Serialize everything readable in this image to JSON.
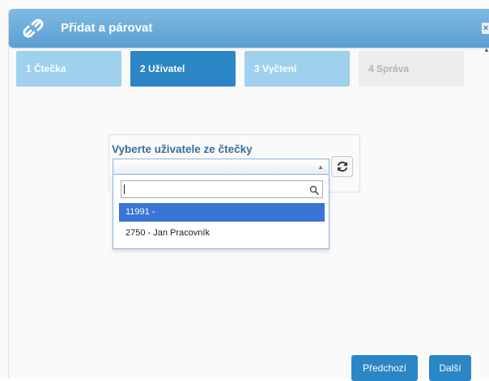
{
  "dialog": {
    "title": "Přidat a párovat",
    "close_label": "×",
    "title_icon": "link-icon"
  },
  "steps": [
    {
      "label": "1 Čtečka",
      "state": "done"
    },
    {
      "label": "2 Uživatel",
      "state": "active"
    },
    {
      "label": "3 Vyčtení",
      "state": "done"
    },
    {
      "label": "4 Správa",
      "state": "disabled"
    }
  ],
  "user_select": {
    "label": "Vyberte uživatele ze čtečky",
    "value": "",
    "search_value": "",
    "options": [
      {
        "label": "11991 -",
        "highlighted": true
      },
      {
        "label": "2750 - Jan Pracovník",
        "highlighted": false
      }
    ]
  },
  "footer": {
    "previous_label": "Předchozí",
    "next_label": "Další"
  },
  "colors": {
    "accent": "#2a86c5",
    "step_done": "#9fd0ee",
    "step_disabled": "#ececec",
    "highlight": "#3875d7"
  }
}
